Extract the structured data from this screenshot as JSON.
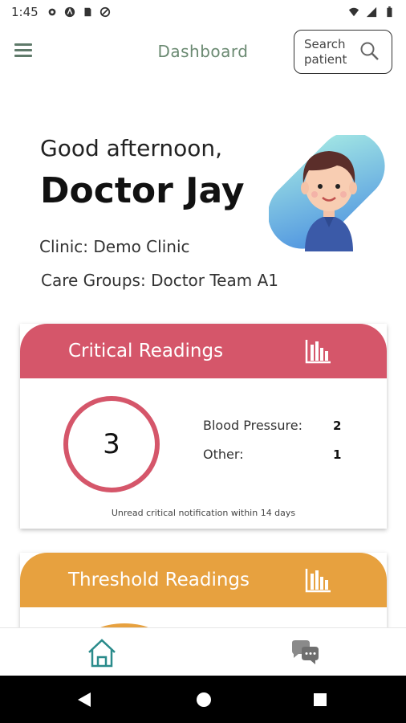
{
  "status_bar": {
    "time": "1:45"
  },
  "app_bar": {
    "title": "Dashboard",
    "search_line1": "Search",
    "search_line2": "patient"
  },
  "greeting": {
    "salutation": "Good afternoon,",
    "name": "Doctor Jay",
    "clinic": "Clinic: Demo Clinic",
    "care_groups": "Care Groups: Doctor Team A1"
  },
  "critical_card": {
    "title": "Critical Readings",
    "count": "3",
    "rows": [
      {
        "label": "Blood Pressure:",
        "value": "2"
      },
      {
        "label": "Other:",
        "value": "1"
      }
    ],
    "note": "Unread critical notification within 14 days",
    "color": "#d5566a"
  },
  "threshold_card": {
    "title": "Threshold Readings",
    "color": "#e7a13f"
  },
  "bottom_nav": {
    "home_icon": "home-icon",
    "chat_icon": "chat-icon"
  }
}
